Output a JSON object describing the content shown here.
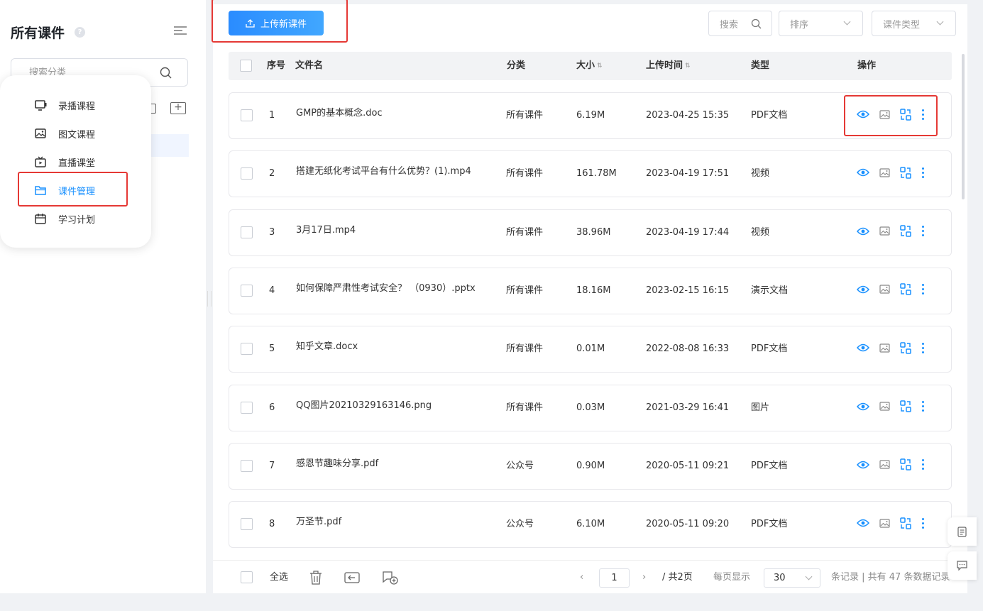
{
  "sidebar": {
    "title": "所有课件",
    "search_placeholder": "搜索分类"
  },
  "popup_menu": {
    "items": [
      {
        "label": "录播课程",
        "icon": "video-lesson-icon"
      },
      {
        "label": "图文课程",
        "icon": "image-text-icon"
      },
      {
        "label": "直播课堂",
        "icon": "live-tv-icon"
      },
      {
        "label": "课件管理",
        "icon": "folder-icon",
        "active": true
      },
      {
        "label": "学习计划",
        "icon": "calendar-icon"
      }
    ]
  },
  "toolbar": {
    "upload_label": "上传新课件",
    "search_label": "搜索",
    "sort_label": "排序",
    "type_label": "课件类型"
  },
  "table": {
    "headers": {
      "index": "序号",
      "name": "文件名",
      "category": "分类",
      "size": "大小",
      "time": "上传时间",
      "type": "类型",
      "ops": "操作"
    },
    "rows": [
      {
        "index": "1",
        "name": "GMP的基本概念.doc",
        "category": "所有课件",
        "size": "6.19M",
        "time": "2023-04-25 15:35",
        "type": "PDF文档"
      },
      {
        "index": "2",
        "name": "搭建无纸化考试平台有什么优势？(1).mp4",
        "category": "所有课件",
        "size": "161.78M",
        "time": "2023-04-19 17:51",
        "type": "视频"
      },
      {
        "index": "3",
        "name": "3月17日.mp4",
        "category": "所有课件",
        "size": "38.96M",
        "time": "2023-04-19 17:44",
        "type": "视频"
      },
      {
        "index": "4",
        "name": "如何保障严肃性考试安全？ （0930）.pptx",
        "category": "所有课件",
        "size": "18.16M",
        "time": "2023-02-15 16:15",
        "type": "演示文档"
      },
      {
        "index": "5",
        "name": "知乎文章.docx",
        "category": "所有课件",
        "size": "0.01M",
        "time": "2022-08-08 16:33",
        "type": "PDF文档"
      },
      {
        "index": "6",
        "name": "QQ图片20210329163146.png",
        "category": "所有课件",
        "size": "0.03M",
        "time": "2021-03-29 16:41",
        "type": "图片"
      },
      {
        "index": "7",
        "name": "感恩节趣味分享.pdf",
        "category": "公众号",
        "size": "0.90M",
        "time": "2020-05-11 09:21",
        "type": "PDF文档"
      },
      {
        "index": "8",
        "name": "万圣节.pdf",
        "category": "公众号",
        "size": "6.10M",
        "time": "2020-05-11 09:20",
        "type": "PDF文档"
      }
    ]
  },
  "footer": {
    "select_all": "全选",
    "current_page": "1",
    "total_pages": "/ 共2页",
    "per_page_label": "每页显示",
    "per_page_value": "30",
    "records_text": "条记录 | 共有 47 条数据记录"
  },
  "colors": {
    "accent": "#1890ff",
    "highlight_box": "#e53935"
  }
}
